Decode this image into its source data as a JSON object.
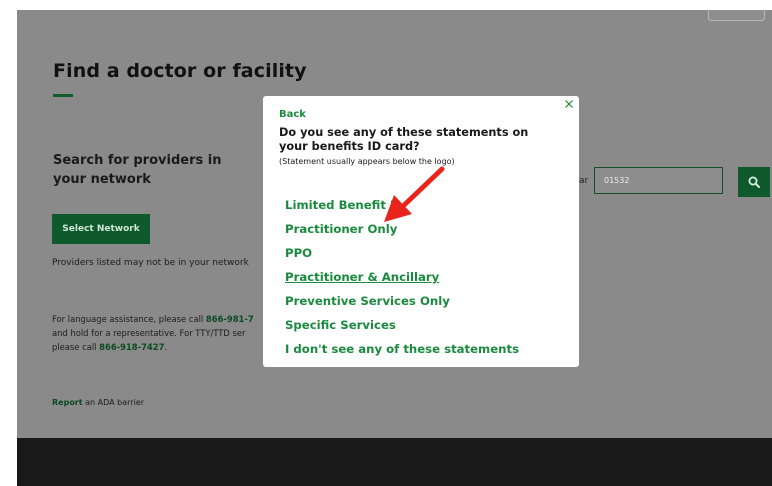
{
  "page": {
    "title": "Find a doctor or facility",
    "search_heading": "Search for providers in your network",
    "select_network_label": "Select Network",
    "network_note": "Providers listed may not be in your network",
    "language_help": {
      "line1_text": "For language assistance, please call ",
      "line1_phone": "866-981-7",
      "line2_text": "and hold for a representative. For TTY/TTD ser",
      "line3_text": "please call ",
      "line3_phone": "866-918-7427",
      "line3_end": "."
    },
    "ada": {
      "link_label": "Report",
      "text": " an ADA barrier"
    },
    "zip_label_fragment": "ar",
    "zip_value": "01532",
    "search_icon": "magnifier-icon"
  },
  "modal": {
    "back_label": "Back",
    "question": "Do you see any of these statements on your benefits ID card?",
    "hint": "(Statement usually appears below the logo)",
    "close_icon": "close-icon",
    "options": [
      {
        "label": "Limited Benefit P"
      },
      {
        "label": "Practitioner Only"
      },
      {
        "label": "PPO"
      },
      {
        "label": "Practitioner & Ancillary"
      },
      {
        "label": "Preventive Services Only"
      },
      {
        "label": "Specific Services"
      },
      {
        "label": "I don't see any of these statements"
      }
    ]
  },
  "annotation": {
    "icon": "red-arrow-icon",
    "color": "#e8241c"
  },
  "colors": {
    "brand_green": "#0e5a2c",
    "link_green": "#1a8a3e",
    "overlay_gray": "#8a8a8a",
    "footer": "#191919"
  }
}
